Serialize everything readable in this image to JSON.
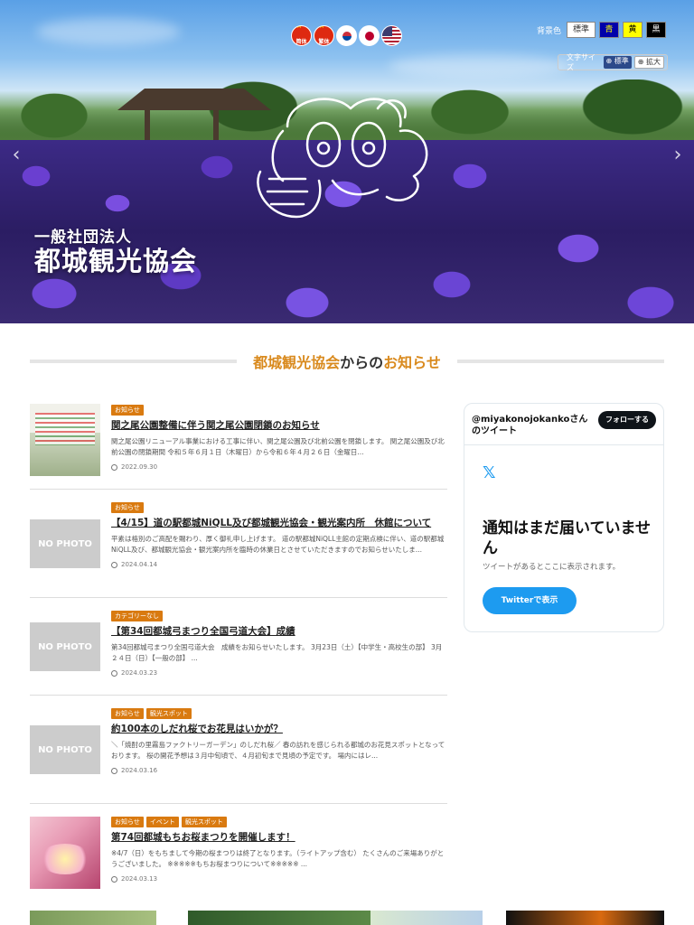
{
  "hero": {
    "org_sub": "一般社団法人",
    "org_name": "都城観光協会"
  },
  "languages": [
    {
      "code": "zh-cn",
      "label": "简体",
      "icon": "china-flag-icon"
    },
    {
      "code": "zh-tw",
      "label": "繁体",
      "icon": "china-flag-icon"
    },
    {
      "code": "ko",
      "label": "",
      "icon": "korea-flag-icon"
    },
    {
      "code": "ja",
      "label": "",
      "icon": "japan-flag-icon"
    },
    {
      "code": "en",
      "label": "",
      "icon": "usa-flag-icon"
    }
  ],
  "accessibility": {
    "bg_label": "背景色",
    "bg_options": [
      "標準",
      "青",
      "黄",
      "黒"
    ],
    "font_label": "文字サイズ",
    "font_options": [
      "標準",
      "拡大"
    ]
  },
  "section": {
    "title_part1": "都城観光協会",
    "title_part2": "からの",
    "title_part3": "お知らせ"
  },
  "news": [
    {
      "thumb": "doc",
      "thumb_label": "",
      "tags": [
        "お知らせ"
      ],
      "title": "関之尾公園整備に伴う関之尾公園閉鎖のお知らせ",
      "excerpt": "関之尾公園リニューアル事業における工事に伴い、関之尾公園及び北前公園を閉鎖します。 関之尾公園及び北前公園の閉鎖期間 令和５年６月１日（木曜日）から令和６年４月２６日（金曜日...",
      "date": "2022.09.30"
    },
    {
      "thumb": "none",
      "thumb_label": "NO PHOTO",
      "tags": [
        "お知らせ"
      ],
      "title": "【4/15】道の駅都城NiQLL及び都城観光協会・観光案内所　休館について",
      "excerpt": "平素は格別のご高配を賜わり、厚く御礼申し上げます。 道の駅都城NiQLL主館の定期点検に伴い、道の駅都城NiQLL及び、都城観光協会・観光案内所を臨時の休業日とさせていただきますのでお知らせいたしま...",
      "date": "2024.04.14"
    },
    {
      "thumb": "none",
      "thumb_label": "NO PHOTO",
      "tags": [
        "カテゴリーなし"
      ],
      "title": "【第34回都城弓まつり全国弓道大会】成績",
      "excerpt": "第34回都城弓まつり全国弓道大会　成績をお知らせいたします。 3月23日（土）【中学生・高校生の部】 3月２４日（日）【一般の部】 ...",
      "date": "2024.03.23"
    },
    {
      "thumb": "none",
      "thumb_label": "NO PHOTO",
      "tags": [
        "お知らせ",
        "観光スポット"
      ],
      "title": "約100本のしだれ桜でお花見はいかが？",
      "excerpt": "＼「焼酎の里霧島ファクトリーガーデン」のしだれ桜／ 春の訪れを感じられる都城のお花見スポットとなっております。 桜の開花予想は３月中旬頃で、４月初旬まで見頃の予定です。 場内にはレ...",
      "date": "2024.03.16"
    },
    {
      "thumb": "sakura",
      "thumb_label": "",
      "tags": [
        "お知らせ",
        "イベント",
        "観光スポット"
      ],
      "title": "第74回都城もちお桜まつりを開催します！",
      "excerpt": "※4/7（日）をもちまして今期の桜まつりは終了となります。（ライトアップ含む） たくさんのご来場ありがとうございました。 ※※※※※もちお桜まつりについて※※※※※ ...",
      "date": "2024.03.13"
    }
  ],
  "twitter": {
    "handle": "@miyakonojokankoさんのツイート",
    "follow_label": "フォローする",
    "headline": "通知はまだ届いていません",
    "sub": "ツイートがあるとここに表示されます。",
    "view_label": "Twitterで表示"
  },
  "colors": {
    "accent": "#d98a1e",
    "tag": "#d97a10",
    "twitter_blue": "#1d9bf0"
  }
}
